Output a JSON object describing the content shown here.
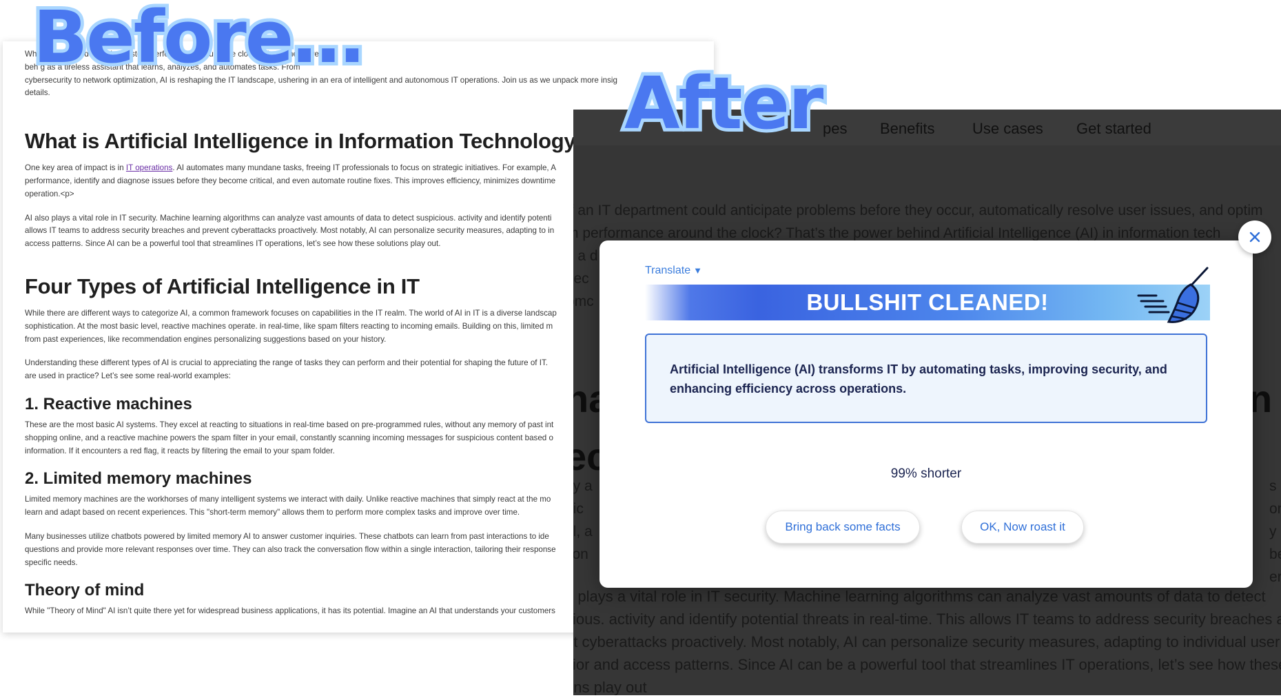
{
  "labels": {
    "before": "Before…",
    "after": "After"
  },
  "before_doc": {
    "intro_lines": [
      "Wh                                                                                              er issues, and optimize system performance around the clock? That’s the power",
      "beh                                                                                             g as a tireless assistant that learns, analyzes, and automates tasks. From",
      "cybersecurity to network optimization, AI is reshaping the IT landscape, ushering in an era of intelligent and autonomous IT operations. Join us as we unpack more insig",
      "details."
    ],
    "h_what": "What is Artificial Intelligence in Information Technology?",
    "p_ops_prefix": "One key area of impact is in ",
    "p_ops_link": "IT operations",
    "p_ops_suffix": ". AI automates many mundane tasks, freeing IT professionals to focus on strategic initiatives. For example, A",
    "p_ops_line2": "performance, identify and diagnose issues before they become critical, and even automate routine fixes. This improves efficiency, minimizes downtime",
    "p_ops_line3": "operation.<p>",
    "p_sec_lines": [
      "AI also plays a vital role in IT security. Machine learning algorithms can analyze vast amounts of data to detect suspicious. activity and identify potenti",
      "allows IT teams to address security breaches and prevent cyberattacks proactively. Most notably, AI can personalize security measures, adapting to in",
      "access patterns. Since AI can be a powerful tool that streamlines IT operations, let’s see how these solutions play out."
    ],
    "h_four": "Four Types of Artificial Intelligence in IT",
    "p_types_lines": [
      "While there are different ways to categorize AI, a common framework focuses on capabilities in the IT realm. The world of AI in IT is a diverse landscap",
      "sophistication. At the most basic level, reactive machines operate. in real-time, like spam filters reacting to incoming emails. Building on this, limited m",
      "from past experiences, like recommendation engines personalizing suggestions based on your history."
    ],
    "p_understand_lines": [
      "Understanding these different types of AI is crucial to appreciating the range of tasks they can perform and their potential for shaping the future of IT.",
      "are used in practice? Let’s see some real-world examples:"
    ],
    "h_reactive": "1. Reactive machines",
    "p_reactive_lines": [
      "These are the most basic AI systems. They excel at reacting to situations in real-time based on pre-programmed rules, without any memory of past int",
      "shopping online, and a reactive machine powers the spam filter in your email, constantly scanning incoming messages for suspicious content based o",
      "information. If it encounters a red flag, it reacts by filtering the email to your spam folder."
    ],
    "h_limited": "2. Limited memory machines",
    "p_limited_lines": [
      "Limited memory machines are the workhorses of many intelligent systems we interact with daily. Unlike reactive machines that simply react at the mo",
      "learn and adapt based on recent experiences. This \"short-term memory\" allows them to perform more complex tasks and improve over time."
    ],
    "p_chatbot_lines": [
      "Many businesses utilize chatbots powered by limited memory AI to answer customer inquiries. These chatbots can learn from past interactions to ide",
      "questions and provide more relevant responses over time. They can also track the conversation flow within a single interaction, tailoring their response",
      "specific needs."
    ],
    "h_theory": "Theory of mind",
    "p_theory": "While \"Theory of Mind\" AI isn’t quite there yet for widespread business applications, it has its potential. Imagine an AI that understands your customers"
  },
  "after_page": {
    "nav": [
      "pes",
      "Benefits",
      "Use cases",
      "Get started"
    ],
    "body_lines": [
      "if an IT department could anticipate problems before they occur, automatically resolve user issues, and optim",
      "m performance around the clock? That’s the power behind Artificial Intelligence (AI) in information tech",
      "s a d",
      "sec",
      "omc"
    ],
    "heading_fragment": "ha",
    "heading_fragment2": "ec",
    "heading_tail": "n",
    "body2_lines": [
      "ey a",
      "gic",
      "al, a",
      "tion"
    ],
    "body2_right": [
      "s on",
      "y be",
      "er"
    ],
    "body3_lines": [
      "o plays a vital role in IT security. Machine learning algorithms can analyze vast amounts of data to detect",
      "cious. activity and identify potential threats in real-time. This allows IT teams to address security breaches an",
      "nt cyberattacks proactively. Most notably, AI can personalize security measures, adapting to individual user",
      "vior and access patterns. Since AI can be a powerful tool that streamlines IT operations, let’s see how these",
      "ons play out"
    ]
  },
  "modal": {
    "translate_label": "Translate",
    "banner_title": "BULLSHIT CLEANED!",
    "summary": "Artificial Intelligence (AI) transforms IT by automating tasks, improving security, and enhancing efficiency across operations.",
    "shorter_text": "99% shorter",
    "btn_facts": "Bring back some facts",
    "btn_roast": "OK, Now roast it"
  },
  "colors": {
    "label_fill": "#4a78f0",
    "label_outline": "#a9d6ff",
    "accent_blue": "#2f6fd8",
    "overlay_dark": "#363636"
  }
}
